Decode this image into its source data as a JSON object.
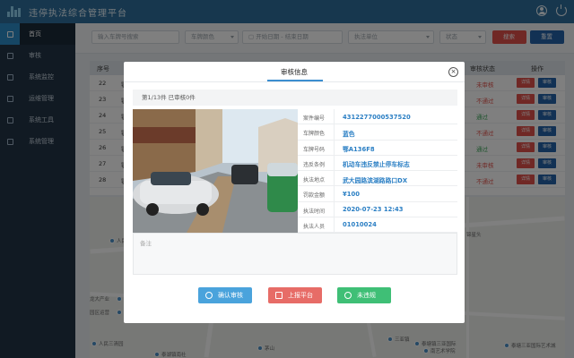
{
  "header": {
    "title": "违停执法综合管理平台",
    "user_icon": "user-icon",
    "power_icon": "power-icon"
  },
  "sidebar": {
    "items": [
      {
        "label": "首页",
        "icon": "home-icon",
        "active": true
      },
      {
        "label": "审核",
        "icon": "audit-icon"
      },
      {
        "label": "系统监控",
        "icon": "monitor-icon"
      },
      {
        "label": "运维管理",
        "icon": "grid-icon"
      },
      {
        "label": "系统工具",
        "icon": "tools-icon"
      },
      {
        "label": "系统管理",
        "icon": "settings-icon"
      }
    ]
  },
  "filters": {
    "plate_placeholder": "输入车牌号搜索",
    "plate_color": "车牌颜色",
    "start_date": "开始日期",
    "date_sep": "-",
    "end_date": "结束日期",
    "enforce_unit": "执法单位",
    "status": "状态",
    "search_label": "搜索",
    "reset_label": "重置"
  },
  "table": {
    "headers": {
      "no": "序号",
      "status": "审核状态",
      "action": "操作"
    },
    "rows": [
      {
        "no": "22",
        "car": "鄂",
        "status": "未审核",
        "status_color": "#e0504a",
        "btn1": "详情",
        "btn2": "审核"
      },
      {
        "no": "23",
        "car": "鄂",
        "status": "不通过",
        "status_color": "#e0504a",
        "btn1": "详情",
        "btn2": "审核"
      },
      {
        "no": "24",
        "car": "鄂",
        "status": "通过",
        "status_color": "#3fa85c",
        "btn1": "详情",
        "btn2": "审核"
      },
      {
        "no": "25",
        "car": "鄂",
        "status": "不通过",
        "status_color": "#e0504a",
        "btn1": "详情",
        "btn2": "审核"
      },
      {
        "no": "26",
        "car": "鄂",
        "status": "通过",
        "status_color": "#3fa85c",
        "btn1": "详情",
        "btn2": "审核"
      },
      {
        "no": "27",
        "car": "鄂",
        "status": "未审核",
        "status_color": "#e0504a",
        "btn1": "详情",
        "btn2": "审核"
      },
      {
        "no": "28",
        "car": "鄂",
        "status": "不通过",
        "status_color": "#e0504a",
        "btn1": "详情",
        "btn2": "审核"
      }
    ]
  },
  "map": {
    "labels": [
      "人民公园",
      "锦星头",
      "龙大产业",
      "园区运营",
      "泰湖镇南社",
      "三亚镇",
      "泰塘镇三亚国际",
      "南艺术学院",
      "茅山",
      "人民三清园",
      "泰塘三亚国际艺术城"
    ]
  },
  "modal": {
    "title": "审核信息",
    "close": "×",
    "progress": "第1/13件 已审核0件",
    "fields": [
      {
        "key": "案件编号",
        "value": "4312277000537520"
      },
      {
        "key": "车牌颜色",
        "value": "蓝色"
      },
      {
        "key": "车牌号码",
        "value": "鄂A136F8"
      },
      {
        "key": "违反条例",
        "value": "机动车违反禁止停车标志"
      },
      {
        "key": "执法地点",
        "value": "武大园路滨湖路路口DX"
      },
      {
        "key": "罚款金额",
        "value": "¥100"
      },
      {
        "key": "执法时间",
        "value": "2020-07-23 12:43"
      },
      {
        "key": "执法人员",
        "value": "01010024"
      }
    ],
    "remark_placeholder": "备注",
    "buttons": {
      "confirm": "确认审核",
      "report": "上报平台",
      "no_violation": "未违规"
    }
  },
  "colors": {
    "topbar": "#2f6f9c",
    "sidebar": "#233547",
    "accent": "#2d8cc9",
    "danger": "#e0504a",
    "success": "#3fbf76"
  }
}
